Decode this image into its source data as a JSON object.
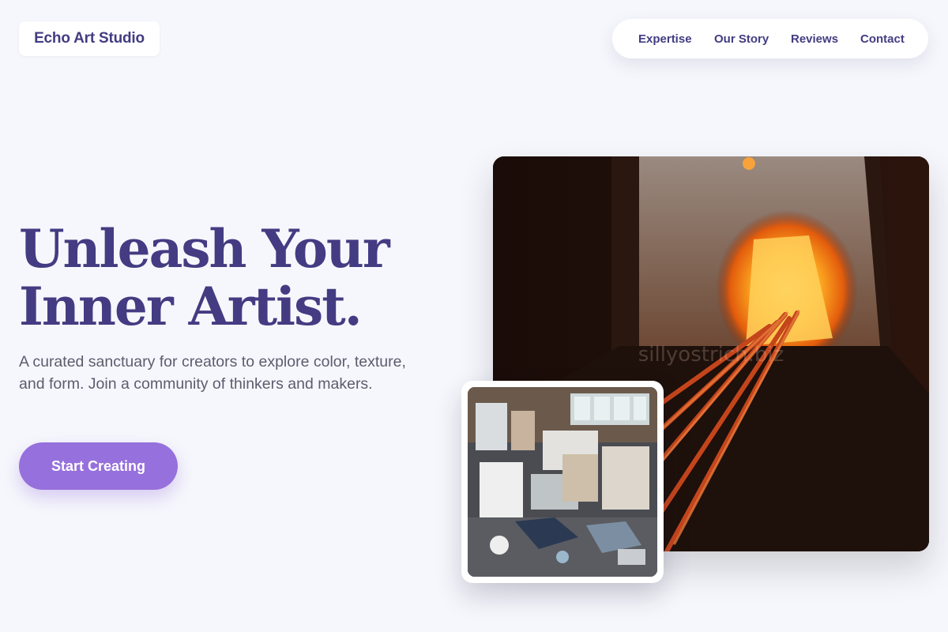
{
  "brand": {
    "name": "Echo Art Studio"
  },
  "nav": {
    "items": [
      {
        "label": "Expertise"
      },
      {
        "label": "Our Story"
      },
      {
        "label": "Reviews"
      },
      {
        "label": "Contact"
      }
    ]
  },
  "hero": {
    "headline_line1": "Unleash Your",
    "headline_line2": "Inner Artist.",
    "subtitle": "A curated sanctuary for creators to explore color, texture, and form. Join a community of thinkers and makers.",
    "cta_label": "Start Creating",
    "main_image": {
      "subject": "glass furnace with glowing rods",
      "watermark": "sillyostrich.biz"
    },
    "inset_image": {
      "subject": "cluttered art studio from above"
    }
  },
  "colors": {
    "background": "#f6f7fc",
    "brand_text": "#433c82",
    "accent": "#9670dc",
    "body_text": "#5b5d6e"
  }
}
